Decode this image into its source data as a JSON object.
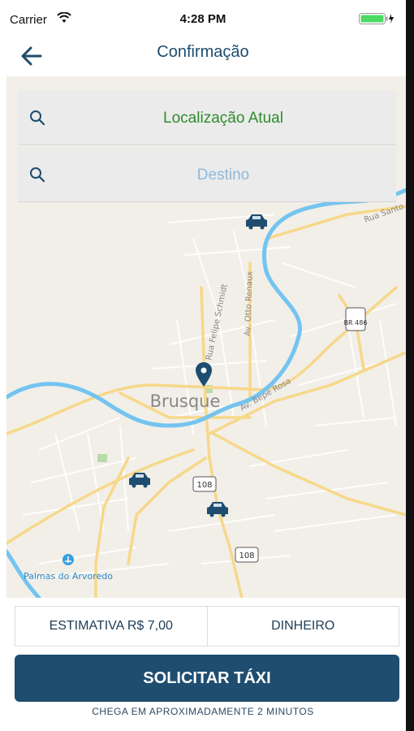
{
  "status_bar": {
    "carrier": "Carrier",
    "time": "4:28 PM"
  },
  "nav": {
    "title": "Confirmação"
  },
  "search": {
    "origin": "Localização Atual",
    "destination": "Destino"
  },
  "map": {
    "city_label": "Brusque",
    "street_labels": [
      "Rua Felipe Schmidt",
      "Av. Otto Renaux",
      "Av. Bepe Rosa",
      "Rua Santo"
    ],
    "highway_shields": [
      "108",
      "108",
      "BR 486"
    ],
    "poi_label": "Palmas do Arvoredo"
  },
  "bottom": {
    "estimate": "ESTIMATIVA R$ 7,00",
    "payment": "DINHEIRO",
    "request_button": "SOLICITAR TÁXI",
    "eta_text": "CHEGA EM APROXIMADAMENTE 2 MINUTOS"
  },
  "colors": {
    "primary": "#1e4d70",
    "origin_text": "#2e8b2e",
    "destination_placeholder": "#8fbadb",
    "water": "#74c4f0",
    "road": "#f7d88a"
  },
  "icons": [
    "wifi-icon",
    "battery-icon",
    "back-arrow-icon",
    "search-icon",
    "location-pin-icon",
    "taxi-car-icon",
    "park-icon"
  ]
}
